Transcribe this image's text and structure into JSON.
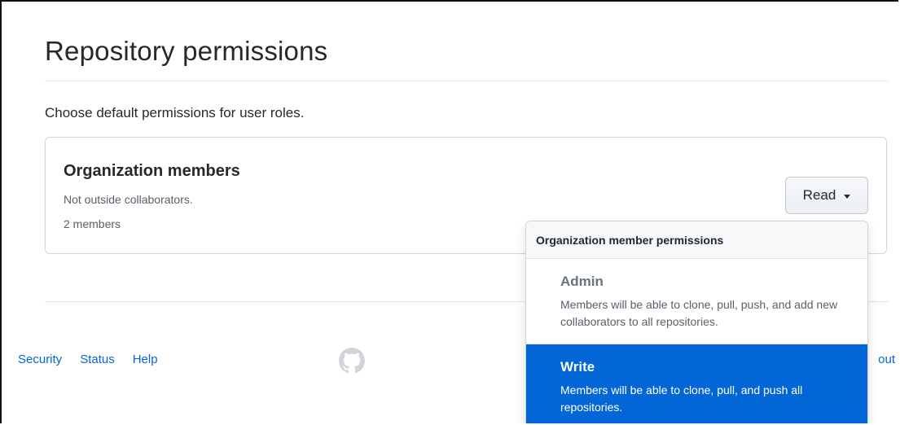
{
  "page": {
    "title": "Repository permissions",
    "description": "Choose default permissions for user roles."
  },
  "card": {
    "title": "Organization members",
    "subtitle": "Not outside collaborators.",
    "count": "2 members",
    "button_label": "Read"
  },
  "dropdown": {
    "header": "Organization member permissions",
    "options": [
      {
        "title": "Admin",
        "description": "Members will be able to clone, pull, push, and add new collaborators to all repositories.",
        "selected": false
      },
      {
        "title": "Write",
        "description": "Members will be able to clone, pull, and push all repositories.",
        "selected": true
      }
    ]
  },
  "footer": {
    "links": [
      "Security",
      "Status",
      "Help"
    ],
    "right_link": "out"
  },
  "colors": {
    "accent": "#0366d6",
    "text": "#24292e",
    "muted": "#586069",
    "border": "#d1d5da"
  },
  "icons": {
    "logo": "github-icon",
    "caret": "caret-down-icon"
  }
}
